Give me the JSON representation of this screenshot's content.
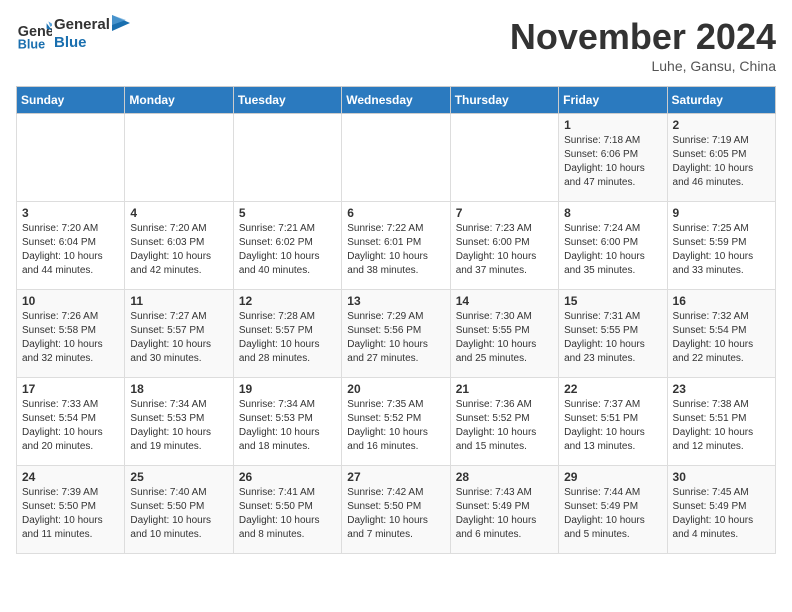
{
  "header": {
    "logo_line1": "General",
    "logo_line2": "Blue",
    "month": "November 2024",
    "location": "Luhe, Gansu, China"
  },
  "weekdays": [
    "Sunday",
    "Monday",
    "Tuesday",
    "Wednesday",
    "Thursday",
    "Friday",
    "Saturday"
  ],
  "weeks": [
    [
      {
        "day": "",
        "info": ""
      },
      {
        "day": "",
        "info": ""
      },
      {
        "day": "",
        "info": ""
      },
      {
        "day": "",
        "info": ""
      },
      {
        "day": "",
        "info": ""
      },
      {
        "day": "1",
        "info": "Sunrise: 7:18 AM\nSunset: 6:06 PM\nDaylight: 10 hours\nand 47 minutes."
      },
      {
        "day": "2",
        "info": "Sunrise: 7:19 AM\nSunset: 6:05 PM\nDaylight: 10 hours\nand 46 minutes."
      }
    ],
    [
      {
        "day": "3",
        "info": "Sunrise: 7:20 AM\nSunset: 6:04 PM\nDaylight: 10 hours\nand 44 minutes."
      },
      {
        "day": "4",
        "info": "Sunrise: 7:20 AM\nSunset: 6:03 PM\nDaylight: 10 hours\nand 42 minutes."
      },
      {
        "day": "5",
        "info": "Sunrise: 7:21 AM\nSunset: 6:02 PM\nDaylight: 10 hours\nand 40 minutes."
      },
      {
        "day": "6",
        "info": "Sunrise: 7:22 AM\nSunset: 6:01 PM\nDaylight: 10 hours\nand 38 minutes."
      },
      {
        "day": "7",
        "info": "Sunrise: 7:23 AM\nSunset: 6:00 PM\nDaylight: 10 hours\nand 37 minutes."
      },
      {
        "day": "8",
        "info": "Sunrise: 7:24 AM\nSunset: 6:00 PM\nDaylight: 10 hours\nand 35 minutes."
      },
      {
        "day": "9",
        "info": "Sunrise: 7:25 AM\nSunset: 5:59 PM\nDaylight: 10 hours\nand 33 minutes."
      }
    ],
    [
      {
        "day": "10",
        "info": "Sunrise: 7:26 AM\nSunset: 5:58 PM\nDaylight: 10 hours\nand 32 minutes."
      },
      {
        "day": "11",
        "info": "Sunrise: 7:27 AM\nSunset: 5:57 PM\nDaylight: 10 hours\nand 30 minutes."
      },
      {
        "day": "12",
        "info": "Sunrise: 7:28 AM\nSunset: 5:57 PM\nDaylight: 10 hours\nand 28 minutes."
      },
      {
        "day": "13",
        "info": "Sunrise: 7:29 AM\nSunset: 5:56 PM\nDaylight: 10 hours\nand 27 minutes."
      },
      {
        "day": "14",
        "info": "Sunrise: 7:30 AM\nSunset: 5:55 PM\nDaylight: 10 hours\nand 25 minutes."
      },
      {
        "day": "15",
        "info": "Sunrise: 7:31 AM\nSunset: 5:55 PM\nDaylight: 10 hours\nand 23 minutes."
      },
      {
        "day": "16",
        "info": "Sunrise: 7:32 AM\nSunset: 5:54 PM\nDaylight: 10 hours\nand 22 minutes."
      }
    ],
    [
      {
        "day": "17",
        "info": "Sunrise: 7:33 AM\nSunset: 5:54 PM\nDaylight: 10 hours\nand 20 minutes."
      },
      {
        "day": "18",
        "info": "Sunrise: 7:34 AM\nSunset: 5:53 PM\nDaylight: 10 hours\nand 19 minutes."
      },
      {
        "day": "19",
        "info": "Sunrise: 7:34 AM\nSunset: 5:53 PM\nDaylight: 10 hours\nand 18 minutes."
      },
      {
        "day": "20",
        "info": "Sunrise: 7:35 AM\nSunset: 5:52 PM\nDaylight: 10 hours\nand 16 minutes."
      },
      {
        "day": "21",
        "info": "Sunrise: 7:36 AM\nSunset: 5:52 PM\nDaylight: 10 hours\nand 15 minutes."
      },
      {
        "day": "22",
        "info": "Sunrise: 7:37 AM\nSunset: 5:51 PM\nDaylight: 10 hours\nand 13 minutes."
      },
      {
        "day": "23",
        "info": "Sunrise: 7:38 AM\nSunset: 5:51 PM\nDaylight: 10 hours\nand 12 minutes."
      }
    ],
    [
      {
        "day": "24",
        "info": "Sunrise: 7:39 AM\nSunset: 5:50 PM\nDaylight: 10 hours\nand 11 minutes."
      },
      {
        "day": "25",
        "info": "Sunrise: 7:40 AM\nSunset: 5:50 PM\nDaylight: 10 hours\nand 10 minutes."
      },
      {
        "day": "26",
        "info": "Sunrise: 7:41 AM\nSunset: 5:50 PM\nDaylight: 10 hours\nand 8 minutes."
      },
      {
        "day": "27",
        "info": "Sunrise: 7:42 AM\nSunset: 5:50 PM\nDaylight: 10 hours\nand 7 minutes."
      },
      {
        "day": "28",
        "info": "Sunrise: 7:43 AM\nSunset: 5:49 PM\nDaylight: 10 hours\nand 6 minutes."
      },
      {
        "day": "29",
        "info": "Sunrise: 7:44 AM\nSunset: 5:49 PM\nDaylight: 10 hours\nand 5 minutes."
      },
      {
        "day": "30",
        "info": "Sunrise: 7:45 AM\nSunset: 5:49 PM\nDaylight: 10 hours\nand 4 minutes."
      }
    ]
  ]
}
